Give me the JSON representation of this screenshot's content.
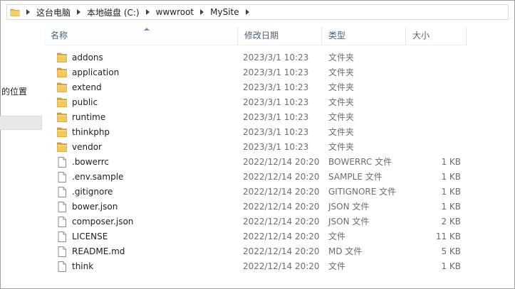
{
  "address": {
    "crumbs": [
      "这台电脑",
      "本地磁盘 (C:)",
      "wwwroot",
      "MySite"
    ]
  },
  "nav": {
    "partial_label": "的位置"
  },
  "columns": {
    "name": "名称",
    "modified": "修改日期",
    "type": "类型",
    "size": "大小"
  },
  "colors": {
    "folder": "#e8b84a",
    "header_text": "#4c607a",
    "detail_text": "#6d6d6d"
  },
  "files": [
    {
      "name": "addons",
      "modified": "2023/3/1 10:23",
      "type": "文件夹",
      "size": "",
      "icon": "folder-icon"
    },
    {
      "name": "application",
      "modified": "2023/3/1 10:23",
      "type": "文件夹",
      "size": "",
      "icon": "folder-icon"
    },
    {
      "name": "extend",
      "modified": "2023/3/1 10:23",
      "type": "文件夹",
      "size": "",
      "icon": "folder-icon"
    },
    {
      "name": "public",
      "modified": "2023/3/1 10:23",
      "type": "文件夹",
      "size": "",
      "icon": "folder-icon"
    },
    {
      "name": "runtime",
      "modified": "2023/3/1 10:23",
      "type": "文件夹",
      "size": "",
      "icon": "folder-icon"
    },
    {
      "name": "thinkphp",
      "modified": "2023/3/1 10:23",
      "type": "文件夹",
      "size": "",
      "icon": "folder-icon"
    },
    {
      "name": "vendor",
      "modified": "2023/3/1 10:23",
      "type": "文件夹",
      "size": "",
      "icon": "folder-icon"
    },
    {
      "name": ".bowerrc",
      "modified": "2022/12/14 20:20",
      "type": "BOWERRC 文件",
      "size": "1 KB",
      "icon": "file-icon"
    },
    {
      "name": ".env.sample",
      "modified": "2022/12/14 20:20",
      "type": "SAMPLE 文件",
      "size": "1 KB",
      "icon": "file-icon"
    },
    {
      "name": ".gitignore",
      "modified": "2022/12/14 20:20",
      "type": "GITIGNORE 文件",
      "size": "1 KB",
      "icon": "file-icon"
    },
    {
      "name": "bower.json",
      "modified": "2022/12/14 20:20",
      "type": "JSON 文件",
      "size": "1 KB",
      "icon": "file-icon"
    },
    {
      "name": "composer.json",
      "modified": "2022/12/14 20:20",
      "type": "JSON 文件",
      "size": "2 KB",
      "icon": "file-icon"
    },
    {
      "name": "LICENSE",
      "modified": "2022/12/14 20:20",
      "type": "文件",
      "size": "11 KB",
      "icon": "file-icon"
    },
    {
      "name": "README.md",
      "modified": "2022/12/14 20:20",
      "type": "MD 文件",
      "size": "5 KB",
      "icon": "file-icon"
    },
    {
      "name": "think",
      "modified": "2022/12/14 20:20",
      "type": "文件",
      "size": "1 KB",
      "icon": "file-icon"
    }
  ]
}
